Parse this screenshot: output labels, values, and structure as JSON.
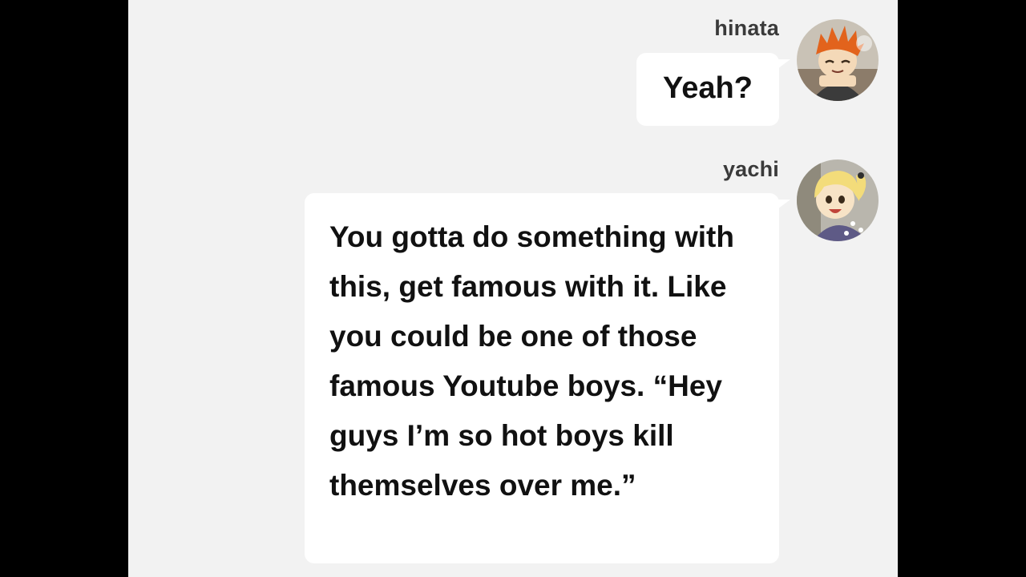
{
  "conversation": {
    "messages": [
      {
        "sender": "hinata",
        "text": "Yeah?",
        "avatar_icon": "hinata-avatar-icon",
        "avatar_colors": {
          "hair": "#e2631c",
          "bg": "#c9c2b6",
          "shirt": "#3b3b3b"
        }
      },
      {
        "sender": "yachi",
        "text": "You gotta do something with this, get famous with it. Like you could be one of those famous Youtube boys. “Hey guys I’m so hot boys kill themselves over me.”",
        "avatar_icon": "yachi-avatar-icon",
        "avatar_colors": {
          "hair": "#f3dc7a",
          "bg": "#b9b6ad",
          "shirt": "#5e5a86"
        }
      }
    ]
  },
  "theme": {
    "panel_bg": "#f2f2f2",
    "bubble_bg": "#ffffff",
    "text": "#111111",
    "username_text": "#3a3a3a",
    "letterbox": "#000000"
  }
}
